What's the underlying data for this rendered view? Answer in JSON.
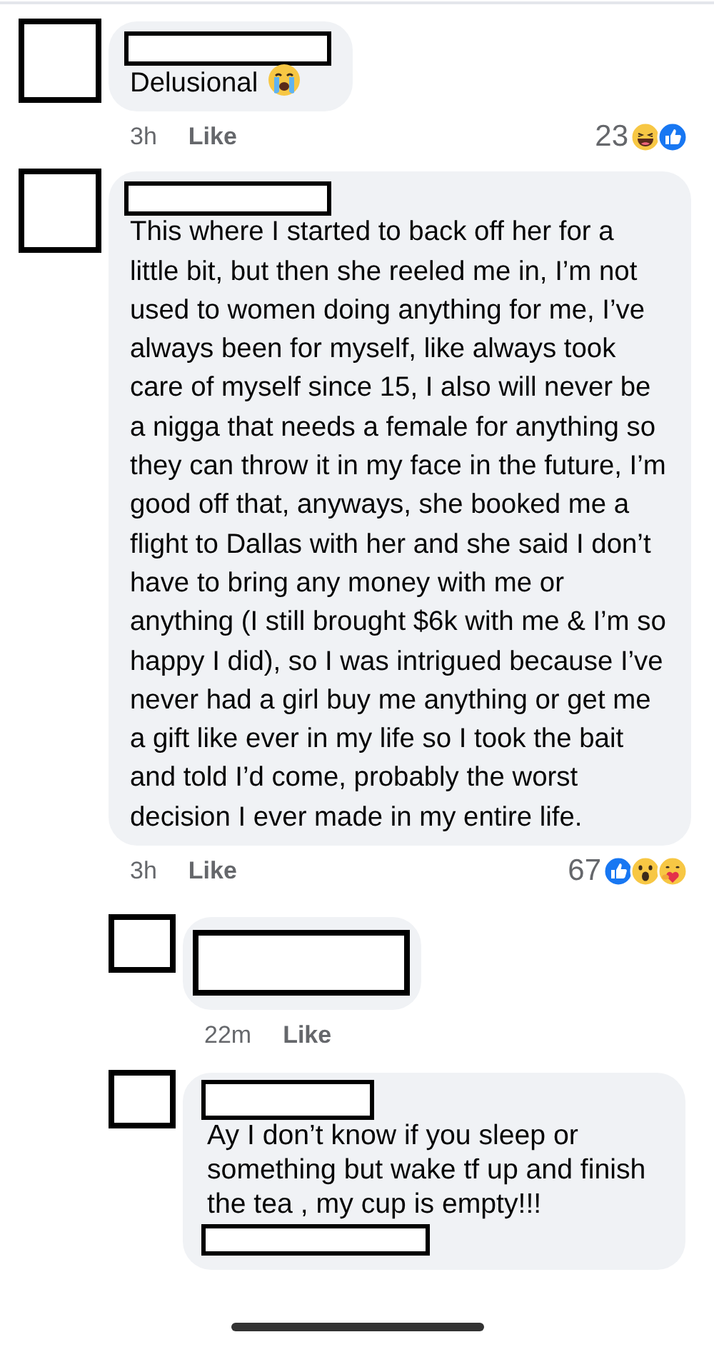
{
  "comments": [
    {
      "text": "Delusional",
      "emoji": {
        "kind": "crying"
      },
      "time": "3h",
      "like_label": "Like",
      "reaction_count": "23",
      "reactions": [
        {
          "kind": "haha"
        },
        {
          "kind": "like"
        }
      ],
      "redacted_footer": false
    },
    {
      "text": "This where I started to back off her for a little bit, but then she reeled me in, I’m not used to women doing anything for me, I’ve always been for myself, like always took care of myself since 15, I also will never be a nigga that needs a female for anything so they can throw it in my face in the future, I’m good off that, anyways, she booked me a flight to Dallas with her and she said I don’t have to bring any money with me or anything (I still brought $6k with me & I’m so happy I did), so I was intrigued because I’ve never had a girl buy me anything or get me a gift like ever in my life so I took the bait and told I’d come, probably the worst decision I ever made in my entire life.",
      "time": "3h",
      "like_label": "Like",
      "reaction_count": "67",
      "reactions": [
        {
          "kind": "like"
        },
        {
          "kind": "wow"
        },
        {
          "kind": "care"
        }
      ],
      "redacted_footer": false,
      "children": [
        {
          "time": "22m",
          "like_label": "Like",
          "redacted_footer": false
        },
        {
          "text": "Ay I don’t know if you sleep or something but wake tf up and finish the tea , my cup is empty!!!",
          "redacted_footer": true
        }
      ]
    }
  ]
}
